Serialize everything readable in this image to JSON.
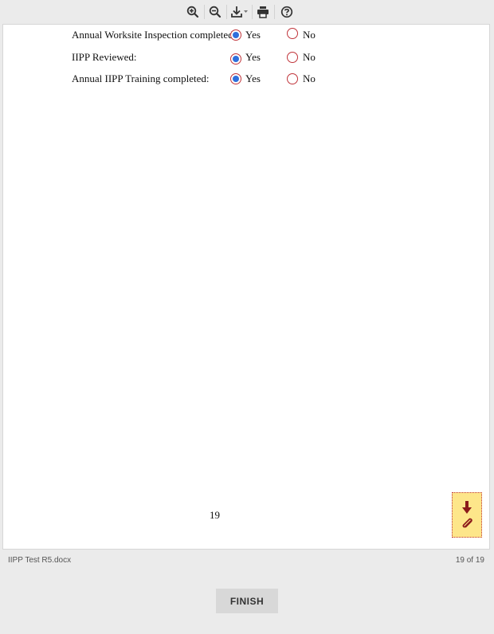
{
  "toolbar": {
    "icons": [
      "zoom-in-icon",
      "zoom-out-icon",
      "download-icon",
      "print-icon",
      "help-icon"
    ]
  },
  "document": {
    "fields": [
      {
        "label": "Annual Worksite Inspection completed:",
        "yes_label": "Yes",
        "no_label": "No",
        "selected": "Yes"
      },
      {
        "label": "IIPP Reviewed:",
        "yes_label": "Yes",
        "no_label": "No",
        "selected": "Yes"
      },
      {
        "label": "Annual IIPP Training completed:",
        "yes_label": "Yes",
        "no_label": "No",
        "selected": "Yes"
      }
    ],
    "page_number": "19"
  },
  "attachment": {
    "icons": [
      "download-arrow-icon",
      "paperclip-icon"
    ],
    "color": "#fde68a"
  },
  "footer": {
    "filename": "IIPP Test R5.docx",
    "page_count": "19 of 19"
  },
  "finish_button": {
    "label": "FINISH"
  },
  "colors": {
    "radio_border": "#c0343a",
    "radio_fill": "#2f6fdc",
    "background": "#ebebeb"
  }
}
